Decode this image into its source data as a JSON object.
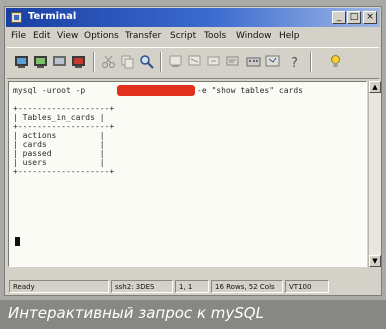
{
  "window": {
    "title": "Terminal",
    "controls": {
      "minimize": "_",
      "maximize": "□",
      "close": "×"
    }
  },
  "menu": [
    "File",
    "Edit",
    "View",
    "Options",
    "Transfer",
    "Script",
    "Tools",
    "Window",
    "Help"
  ],
  "toolbar_icons": [
    "new-session-icon",
    "open-icon",
    "save-icon",
    "print-icon",
    "cut-icon",
    "copy-icon",
    "find-icon",
    "connect-icon",
    "disconnect-icon",
    "reconnect-icon",
    "settings-icon",
    "keymap-icon",
    "help-icon",
    "tips-icon"
  ],
  "terminal": {
    "command_prefix": "mysql -uroot -p",
    "command_suffix": "-e \"show tables\" cards",
    "table_border_top": "+-------------------+",
    "table_header": "| Tables_in_cards |",
    "table_border_mid": "+-------------------+",
    "rows": [
      "| actions         |",
      "| cards           |",
      "| passed          |",
      "| users           |"
    ],
    "table_border_bottom": "+-------------------+"
  },
  "status": {
    "state": "Ready",
    "session": "ssh2: 3DES",
    "cursor": "1, 1",
    "size": "16 Rows, 52 Cols",
    "terminal_type": "VT100"
  },
  "caption": "Интерактивный запрос к mySQL",
  "colors": {
    "titlebar": "#1a3fa2",
    "redaction": "#e2301e",
    "caption_bg": "#878884"
  }
}
